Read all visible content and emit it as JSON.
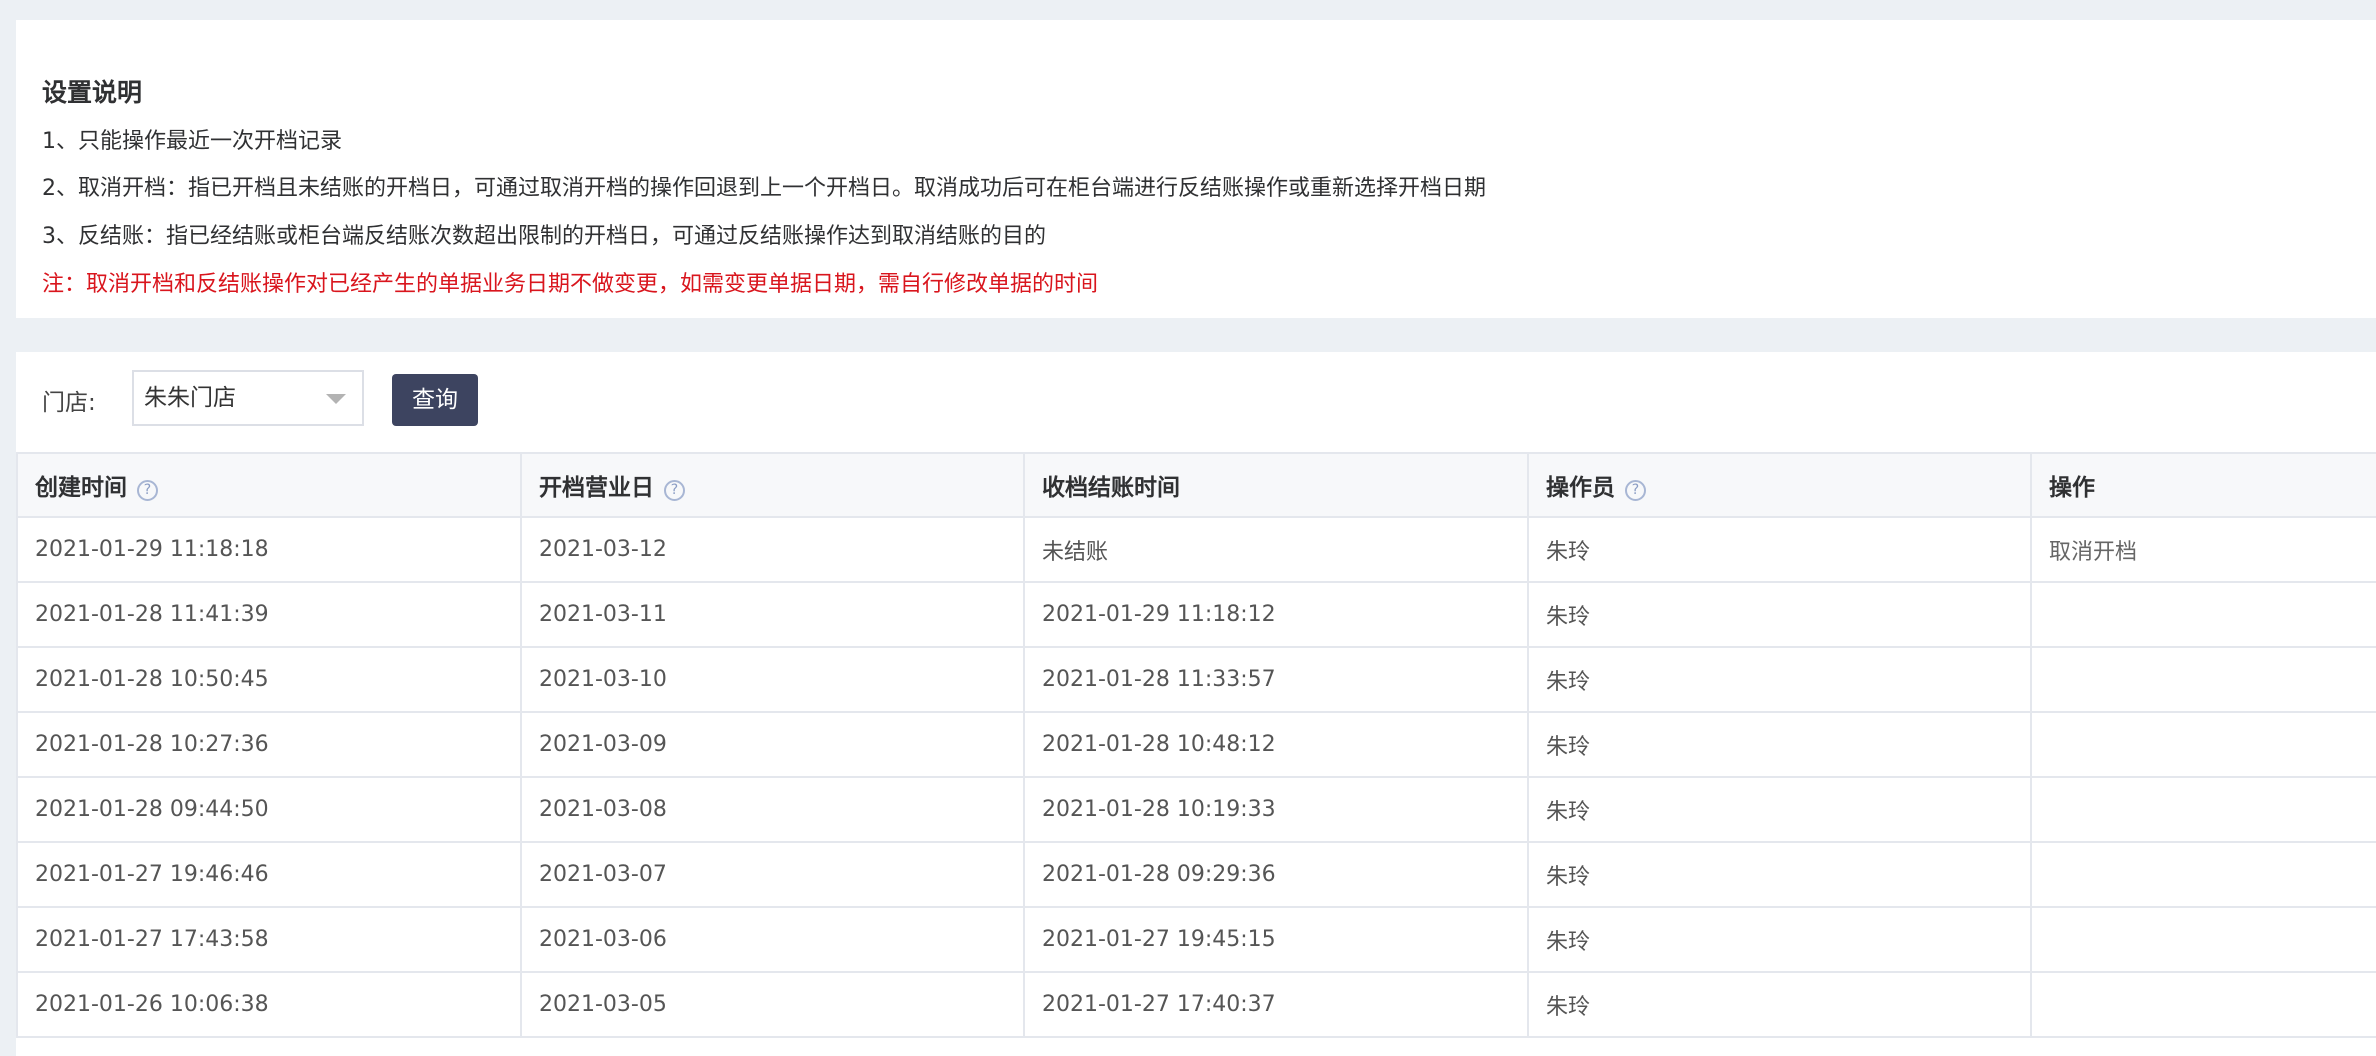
{
  "notes": {
    "title": "设置说明",
    "lines": [
      "1、只能操作最近一次开档记录",
      "2、取消开档：指已开档且未结账的开档日，可通过取消开档的操作回退到上一个开档日。取消成功后可在柜台端进行反结账操作或重新选择开档日期",
      "3、反结账：指已经结账或柜台端反结账次数超出限制的开档日，可通过反结账操作达到取消结账的目的"
    ],
    "warning": "注：取消开档和反结账操作对已经产生的单据业务日期不做变更，如需变更单据日期，需自行修改单据的时间",
    "warning_color": "#d9151d"
  },
  "filter": {
    "store_label": "门店:",
    "store_value": "朱朱门店",
    "query_button": "查询",
    "button_color": "#3d4460"
  },
  "table": {
    "headers": {
      "created": "创建时间",
      "business_day": "开档营业日",
      "close_time": "收档结账时间",
      "operator": "操作员",
      "action": "操作"
    },
    "help_glyph": "?",
    "rows": [
      {
        "created": "2021-01-29 11:18:18",
        "business_day": "2021-03-12",
        "close_time": "未结账",
        "operator": "朱玲",
        "action": "取消开档"
      },
      {
        "created": "2021-01-28 11:41:39",
        "business_day": "2021-03-11",
        "close_time": "2021-01-29 11:18:12",
        "operator": "朱玲",
        "action": ""
      },
      {
        "created": "2021-01-28 10:50:45",
        "business_day": "2021-03-10",
        "close_time": "2021-01-28 11:33:57",
        "operator": "朱玲",
        "action": ""
      },
      {
        "created": "2021-01-28 10:27:36",
        "business_day": "2021-03-09",
        "close_time": "2021-01-28 10:48:12",
        "operator": "朱玲",
        "action": ""
      },
      {
        "created": "2021-01-28 09:44:50",
        "business_day": "2021-03-08",
        "close_time": "2021-01-28 10:19:33",
        "operator": "朱玲",
        "action": ""
      },
      {
        "created": "2021-01-27 19:46:46",
        "business_day": "2021-03-07",
        "close_time": "2021-01-28 09:29:36",
        "operator": "朱玲",
        "action": ""
      },
      {
        "created": "2021-01-27 17:43:58",
        "business_day": "2021-03-06",
        "close_time": "2021-01-27 19:45:15",
        "operator": "朱玲",
        "action": ""
      },
      {
        "created": "2021-01-26 10:06:38",
        "business_day": "2021-03-05",
        "close_time": "2021-01-27 17:40:37",
        "operator": "朱玲",
        "action": ""
      }
    ]
  }
}
